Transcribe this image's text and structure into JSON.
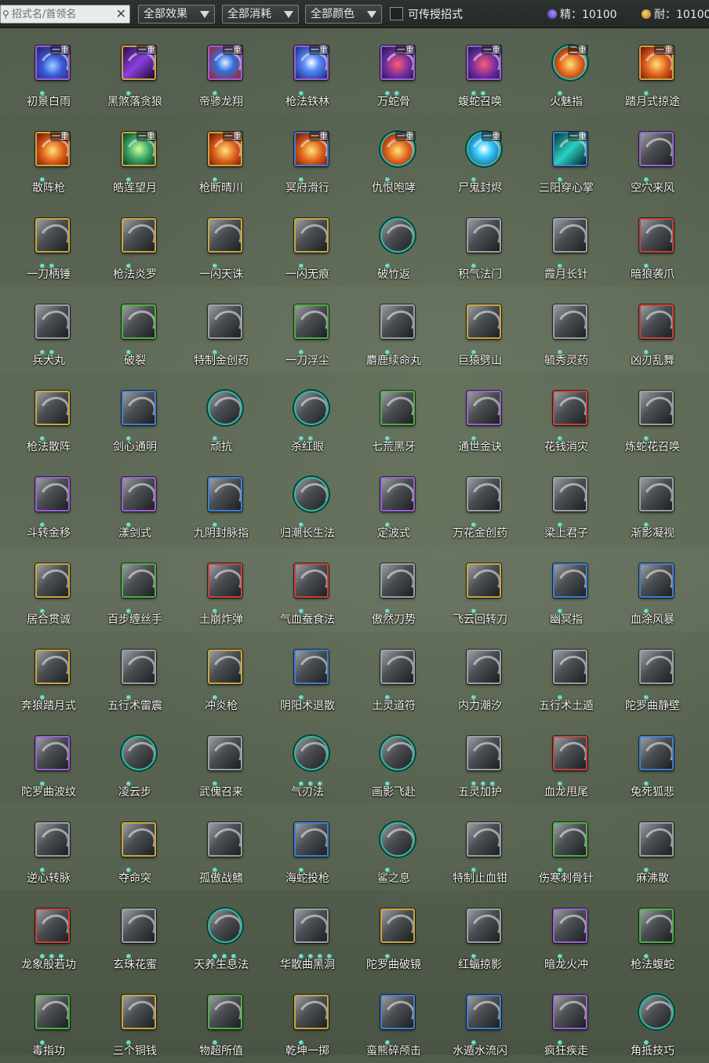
{
  "filter_bar": {
    "search_placeholder": "招式名/首领名",
    "clear_glyph": "✕",
    "effect_dropdown": "全部效果",
    "cost_dropdown": "全部消耗",
    "color_dropdown": "全部颜色",
    "teachable_label": "可传授招式",
    "teachable_checked": false,
    "jing_label": "精：10100",
    "nai_label": "耐：10100"
  },
  "colors": {
    "gold": "#c9a640",
    "purple": "#9b5fd6",
    "blue": "#3f7ed6",
    "red": "#c8423c",
    "green": "#4fae45",
    "gray": "#9aa0a4",
    "teal": "#39b5a0"
  },
  "skills": [
    {
      "name": "初景白雨",
      "tier": "一重",
      "frame": "purple",
      "dots": 1,
      "art": "blue-vortex"
    },
    {
      "name": "黑煞落贪狼",
      "tier": "一重",
      "frame": "gold",
      "dots": 1,
      "art": "purple-slash"
    },
    {
      "name": "帝骖龙翔",
      "tier": "一重",
      "frame": "purple",
      "dots": 1,
      "art": "blue-swirl"
    },
    {
      "name": "枪法铁林",
      "tier": "一重",
      "frame": "purple",
      "dots": 1,
      "art": "lightning"
    },
    {
      "name": "万蛇骨",
      "tier": "一重",
      "frame": "purple",
      "dots": 2,
      "art": "serpent"
    },
    {
      "name": "蝮蛇召唤",
      "tier": "一重",
      "frame": "purple",
      "dots": 2,
      "art": "serpent"
    },
    {
      "name": "火魅指",
      "tier": "二重",
      "frame": "teal",
      "dots": 1,
      "art": "fire"
    },
    {
      "name": "踏月式掠途",
      "tier": "一重",
      "frame": "gold",
      "dots": 1,
      "art": "fire"
    },
    {
      "name": "散阵枪",
      "tier": "一重",
      "frame": "gold",
      "dots": 1,
      "art": "fire"
    },
    {
      "name": "皓莲望月",
      "tier": "一重",
      "frame": "gold",
      "dots": 1,
      "art": "moon"
    },
    {
      "name": "枪断晴川",
      "tier": "一重",
      "frame": "gold",
      "dots": 1,
      "art": "fire"
    },
    {
      "name": "冥府滑行",
      "tier": "一重",
      "frame": "blue",
      "dots": 1,
      "art": "fire"
    },
    {
      "name": "仇恨咆哮",
      "tier": "一重",
      "frame": "teal",
      "dots": 1,
      "art": "fire"
    },
    {
      "name": "尸鬼封烬",
      "tier": "一重",
      "frame": "teal",
      "dots": 1,
      "art": "blue-orb"
    },
    {
      "name": "三阳穿心掌",
      "tier": "一重",
      "frame": "blue",
      "dots": 1,
      "art": "teal-slash"
    },
    {
      "name": "空穴来风",
      "tier": "",
      "frame": "purple",
      "dots": 1,
      "art": "gray"
    },
    {
      "name": "一刀柄锤",
      "tier": "",
      "frame": "gold",
      "dots": 2,
      "art": "gray"
    },
    {
      "name": "枪法炎罗",
      "tier": "",
      "frame": "gold",
      "dots": 1,
      "art": "gray"
    },
    {
      "name": "一闪天诛",
      "tier": "",
      "frame": "gold",
      "dots": 1,
      "art": "gray"
    },
    {
      "name": "一闪无痕",
      "tier": "",
      "frame": "gold",
      "dots": 1,
      "art": "gray"
    },
    {
      "name": "破竹返",
      "tier": "",
      "frame": "teal",
      "dots": 1,
      "art": "gray"
    },
    {
      "name": "积气法门",
      "tier": "",
      "frame": "gray",
      "dots": 1,
      "art": "gray"
    },
    {
      "name": "霞月长针",
      "tier": "",
      "frame": "gray",
      "dots": 1,
      "art": "gray"
    },
    {
      "name": "暗狼袭爪",
      "tier": "",
      "frame": "red",
      "dots": 1,
      "art": "gray"
    },
    {
      "name": "兵犬丸",
      "tier": "",
      "frame": "gray",
      "dots": 2,
      "art": "gray"
    },
    {
      "name": "破裂",
      "tier": "",
      "frame": "green",
      "dots": 1,
      "art": "gray"
    },
    {
      "name": "特制金创药",
      "tier": "",
      "frame": "gray",
      "dots": 1,
      "art": "gray"
    },
    {
      "name": "一刀浮尘",
      "tier": "",
      "frame": "green",
      "dots": 1,
      "art": "gray"
    },
    {
      "name": "麝鹿续命丸",
      "tier": "",
      "frame": "gray",
      "dots": 1,
      "art": "gray"
    },
    {
      "name": "巨猿劈山",
      "tier": "",
      "frame": "gold",
      "dots": 1,
      "art": "gray"
    },
    {
      "name": "毓秀灵药",
      "tier": "",
      "frame": "gray",
      "dots": 1,
      "art": "gray"
    },
    {
      "name": "凶刃乱舞",
      "tier": "",
      "frame": "red",
      "dots": 1,
      "art": "gray"
    },
    {
      "name": "枪法散阵",
      "tier": "",
      "frame": "gold",
      "dots": 1,
      "art": "gray"
    },
    {
      "name": "剑心通明",
      "tier": "",
      "frame": "blue",
      "dots": 1,
      "art": "gray"
    },
    {
      "name": "顽抗",
      "tier": "",
      "frame": "teal",
      "dots": 1,
      "art": "gray"
    },
    {
      "name": "杀红眼",
      "tier": "",
      "frame": "teal",
      "dots": 2,
      "art": "gray"
    },
    {
      "name": "七荒黑牙",
      "tier": "",
      "frame": "green",
      "dots": 1,
      "art": "gray"
    },
    {
      "name": "通世金诀",
      "tier": "",
      "frame": "purple",
      "dots": 1,
      "art": "gray"
    },
    {
      "name": "花钱消灾",
      "tier": "",
      "frame": "red",
      "dots": 1,
      "art": "gray"
    },
    {
      "name": "炼蛇花召唤",
      "tier": "",
      "frame": "gray",
      "dots": 1,
      "art": "gray"
    },
    {
      "name": "斗转金移",
      "tier": "",
      "frame": "purple",
      "dots": 1,
      "art": "gray"
    },
    {
      "name": "漾剑式",
      "tier": "",
      "frame": "purple",
      "dots": 1,
      "art": "gray"
    },
    {
      "name": "九阴封脉指",
      "tier": "",
      "frame": "blue",
      "dots": 1,
      "art": "gray"
    },
    {
      "name": "归潮长生法",
      "tier": "",
      "frame": "teal",
      "dots": 1,
      "art": "gray"
    },
    {
      "name": "定波式",
      "tier": "",
      "frame": "purple",
      "dots": 1,
      "art": "gray"
    },
    {
      "name": "万花金创药",
      "tier": "",
      "frame": "gray",
      "dots": 1,
      "art": "gray"
    },
    {
      "name": "梁上君子",
      "tier": "",
      "frame": "gray",
      "dots": 1,
      "art": "gray"
    },
    {
      "name": "渐影凝视",
      "tier": "",
      "frame": "gray",
      "dots": 1,
      "art": "gray"
    },
    {
      "name": "居合贯诚",
      "tier": "",
      "frame": "gold",
      "dots": 1,
      "art": "gray"
    },
    {
      "name": "百步缠丝手",
      "tier": "",
      "frame": "green",
      "dots": 1,
      "art": "gray"
    },
    {
      "name": "土崩炸弹",
      "tier": "",
      "frame": "red",
      "dots": 1,
      "art": "gray"
    },
    {
      "name": "气血蚕食法",
      "tier": "",
      "frame": "red",
      "dots": 1,
      "art": "gray"
    },
    {
      "name": "傲然刀势",
      "tier": "",
      "frame": "gray",
      "dots": 1,
      "art": "gray"
    },
    {
      "name": "飞云回转刀",
      "tier": "",
      "frame": "gold",
      "dots": 1,
      "art": "gray"
    },
    {
      "name": "幽冥指",
      "tier": "",
      "frame": "blue",
      "dots": 1,
      "art": "gray"
    },
    {
      "name": "血涂风暴",
      "tier": "",
      "frame": "blue",
      "dots": 1,
      "art": "gray"
    },
    {
      "name": "奔狼踏月式",
      "tier": "",
      "frame": "gold",
      "dots": 1,
      "art": "gray"
    },
    {
      "name": "五行术雷震",
      "tier": "",
      "frame": "gray",
      "dots": 1,
      "art": "gray"
    },
    {
      "name": "冲炎枪",
      "tier": "",
      "frame": "gold",
      "dots": 1,
      "art": "gray"
    },
    {
      "name": "阴阳术退散",
      "tier": "",
      "frame": "blue",
      "dots": 1,
      "art": "gray"
    },
    {
      "name": "土灵道符",
      "tier": "",
      "frame": "gray",
      "dots": 1,
      "art": "gray"
    },
    {
      "name": "内力潮汐",
      "tier": "",
      "frame": "gray",
      "dots": 1,
      "art": "gray"
    },
    {
      "name": "五行术土遁",
      "tier": "",
      "frame": "gray",
      "dots": 1,
      "art": "gray"
    },
    {
      "name": "陀罗曲静壁",
      "tier": "",
      "frame": "gray",
      "dots": 1,
      "art": "gray"
    },
    {
      "name": "陀罗曲波纹",
      "tier": "",
      "frame": "purple",
      "dots": 1,
      "art": "gray"
    },
    {
      "name": "凌云步",
      "tier": "",
      "frame": "teal",
      "dots": 1,
      "art": "gray"
    },
    {
      "name": "武傀召来",
      "tier": "",
      "frame": "gray",
      "dots": 1,
      "art": "gray"
    },
    {
      "name": "气刃法",
      "tier": "",
      "frame": "teal",
      "dots": 3,
      "art": "gray"
    },
    {
      "name": "画影飞赴",
      "tier": "",
      "frame": "teal",
      "dots": 1,
      "art": "gray"
    },
    {
      "name": "五灵加护",
      "tier": "",
      "frame": "gray",
      "dots": 3,
      "art": "gray"
    },
    {
      "name": "血龙甩尾",
      "tier": "",
      "frame": "red",
      "dots": 1,
      "art": "gray"
    },
    {
      "name": "兔死狐悲",
      "tier": "",
      "frame": "blue",
      "dots": 1,
      "art": "gray"
    },
    {
      "name": "逆心转脉",
      "tier": "",
      "frame": "gray",
      "dots": 1,
      "art": "gray"
    },
    {
      "name": "夺命突",
      "tier": "",
      "frame": "gold",
      "dots": 1,
      "art": "gray"
    },
    {
      "name": "孤傲战鳍",
      "tier": "",
      "frame": "gray",
      "dots": 1,
      "art": "gray"
    },
    {
      "name": "海蛇投枪",
      "tier": "",
      "frame": "blue",
      "dots": 1,
      "art": "gray"
    },
    {
      "name": "鲨之息",
      "tier": "",
      "frame": "teal",
      "dots": 1,
      "art": "gray"
    },
    {
      "name": "特制止血钳",
      "tier": "",
      "frame": "gray",
      "dots": 1,
      "art": "gray"
    },
    {
      "name": "伤寒刺骨针",
      "tier": "",
      "frame": "green",
      "dots": 1,
      "art": "gray"
    },
    {
      "name": "麻沸散",
      "tier": "",
      "frame": "gray",
      "dots": 1,
      "art": "gray"
    },
    {
      "name": "龙象般若功",
      "tier": "",
      "frame": "red",
      "dots": 3,
      "art": "gray"
    },
    {
      "name": "玄珠花蜜",
      "tier": "",
      "frame": "gray",
      "dots": 1,
      "art": "gray"
    },
    {
      "name": "天养生息法",
      "tier": "",
      "frame": "teal",
      "dots": 3,
      "art": "gray"
    },
    {
      "name": "华散曲黑洞",
      "tier": "",
      "frame": "gray",
      "dots": 4,
      "art": "gray"
    },
    {
      "name": "陀罗曲破镜",
      "tier": "",
      "frame": "gold",
      "dots": 1,
      "art": "gray"
    },
    {
      "name": "红蝠掠影",
      "tier": "",
      "frame": "gray",
      "dots": 1,
      "art": "gray"
    },
    {
      "name": "暗龙火冲",
      "tier": "",
      "frame": "purple",
      "dots": 1,
      "art": "gray"
    },
    {
      "name": "枪法蝮蛇",
      "tier": "",
      "frame": "green",
      "dots": 1,
      "art": "gray"
    },
    {
      "name": "毒指功",
      "tier": "",
      "frame": "green",
      "dots": 1,
      "art": "gray"
    },
    {
      "name": "三个铜钱",
      "tier": "",
      "frame": "gold",
      "dots": 1,
      "art": "gray"
    },
    {
      "name": "物超所值",
      "tier": "",
      "frame": "green",
      "dots": 1,
      "art": "gray"
    },
    {
      "name": "乾坤一掷",
      "tier": "",
      "frame": "gold",
      "dots": 1,
      "art": "gray"
    },
    {
      "name": "蛮熊碎颅击",
      "tier": "",
      "frame": "blue",
      "dots": 1,
      "art": "gray"
    },
    {
      "name": "水遁水流闪",
      "tier": "",
      "frame": "blue",
      "dots": 1,
      "art": "gray"
    },
    {
      "name": "疯狂疾走",
      "tier": "",
      "frame": "purple",
      "dots": 1,
      "art": "gray"
    },
    {
      "name": "角抵技巧",
      "tier": "",
      "frame": "teal",
      "dots": 1,
      "art": "gray"
    }
  ]
}
